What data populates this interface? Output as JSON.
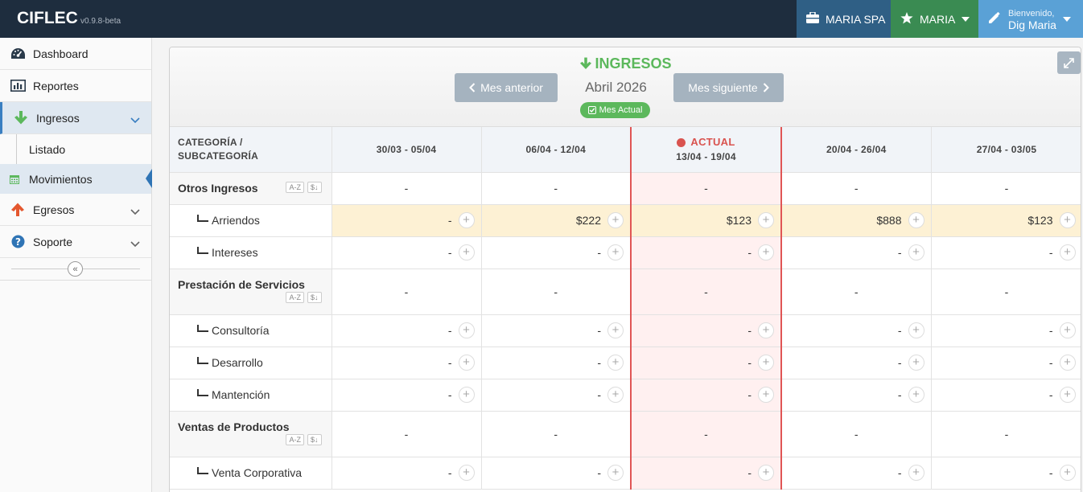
{
  "topbar": {
    "brand": "CIFLEC",
    "version": "v0.9.8-beta",
    "company": "MARIA SPA",
    "user": "MARIA",
    "welcome_small": "Bienvenido,",
    "welcome_name": "Dig Maria",
    "colors": {
      "bg": "#1e2d3e",
      "company": "#2f5f85",
      "user": "#3a8b52",
      "welcome": "#5aa1d6"
    }
  },
  "sidebar": {
    "items": [
      {
        "label": "Dashboard",
        "icon": "dashboard-icon"
      },
      {
        "label": "Reportes",
        "icon": "bar-chart-icon"
      },
      {
        "label": "Ingresos",
        "icon": "arrow-down-icon",
        "active": true
      },
      {
        "label": "Egresos",
        "icon": "arrow-up-icon"
      },
      {
        "label": "Soporte",
        "icon": "question-circle-icon"
      }
    ],
    "subitems": [
      {
        "label": "Listado"
      },
      {
        "label": "Movimientos",
        "active": true,
        "icon": "calendar-icon"
      }
    ],
    "collapse_icon": "double-chevron-left-icon"
  },
  "header": {
    "title": "INGRESOS",
    "prev_label": "Mes anterior",
    "next_label": "Mes siguiente",
    "month": "Abril 2026",
    "badge": "Mes Actual",
    "accent": "#5cb85c"
  },
  "table": {
    "category_header_line1": "CATEGORÍA /",
    "category_header_line2": "SUBCATEGORÍA",
    "weeks": [
      "30/03 - 05/04",
      "06/04 - 12/04",
      "13/04 - 19/04",
      "20/04 - 26/04",
      "27/04 - 03/05"
    ],
    "actual_label": "ACTUAL",
    "sort_az": "A-Z",
    "sort_amount": "$↓",
    "rows": [
      {
        "type": "category",
        "name": "Otros Ingresos",
        "values": [
          "-",
          "-",
          "-",
          "-",
          "-"
        ]
      },
      {
        "type": "sub",
        "name": "Arriendos",
        "values": [
          "-",
          "$222",
          "$123",
          "$888",
          "$123"
        ]
      },
      {
        "type": "sub",
        "name": "Intereses",
        "values": [
          "-",
          "-",
          "-",
          "-",
          "-"
        ]
      },
      {
        "type": "category",
        "name": "Prestación de Servicios",
        "values": [
          "-",
          "-",
          "-",
          "-",
          "-"
        ]
      },
      {
        "type": "sub",
        "name": "Consultoría",
        "values": [
          "-",
          "-",
          "-",
          "-",
          "-"
        ]
      },
      {
        "type": "sub",
        "name": "Desarrollo",
        "values": [
          "-",
          "-",
          "-",
          "-",
          "-"
        ]
      },
      {
        "type": "sub",
        "name": "Mantención",
        "values": [
          "-",
          "-",
          "-",
          "-",
          "-"
        ]
      },
      {
        "type": "category",
        "name": "Ventas de Productos",
        "values": [
          "-",
          "-",
          "-",
          "-",
          "-"
        ]
      },
      {
        "type": "sub",
        "name": "Venta Corporativa",
        "values": [
          "-",
          "-",
          "-",
          "-",
          "-"
        ]
      }
    ]
  }
}
